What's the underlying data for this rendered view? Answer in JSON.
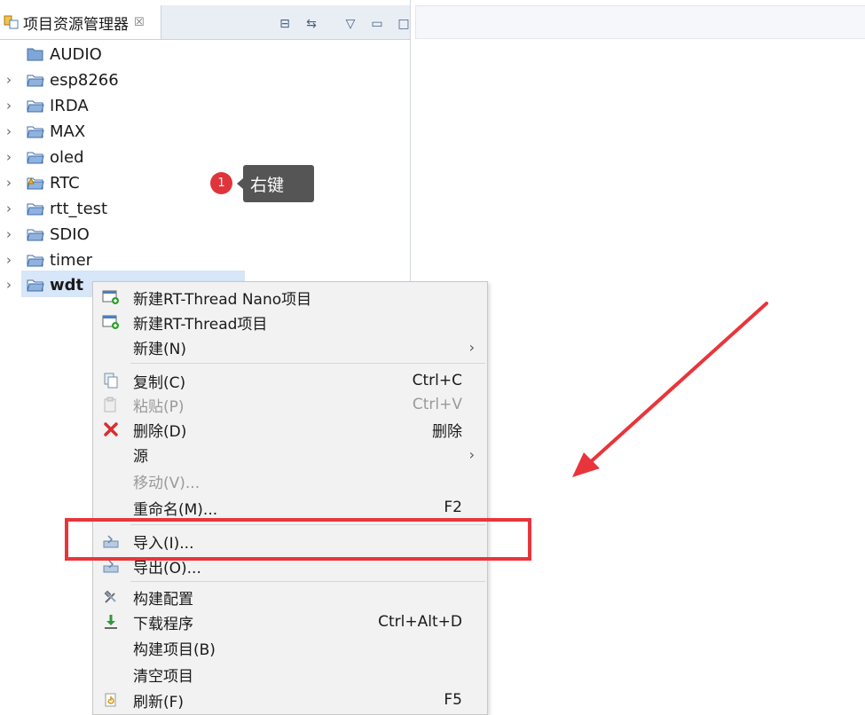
{
  "explorer": {
    "tab_title": "项目资源管理器",
    "tab_close": "☒",
    "tools": {
      "collapse": "⊟",
      "link": "⇆",
      "view_menu": "▽",
      "minimize": "▭",
      "maximize": "□"
    },
    "items": [
      {
        "label": "AUDIO",
        "expandable": false
      },
      {
        "label": "esp8266",
        "expandable": true
      },
      {
        "label": "IRDA",
        "expandable": true
      },
      {
        "label": "MAX",
        "expandable": true
      },
      {
        "label": "oled",
        "expandable": true
      },
      {
        "label": "RTC",
        "expandable": true
      },
      {
        "label": "rtt_test",
        "expandable": true
      },
      {
        "label": "SDIO",
        "expandable": true
      },
      {
        "label": "timer",
        "expandable": true
      },
      {
        "label": "wdt",
        "expandable": true,
        "selected": true
      }
    ],
    "chevron": "›"
  },
  "callout": {
    "step": "1",
    "text": "右键"
  },
  "context_menu": {
    "items": [
      {
        "label": "新建RT-Thread Nano项目",
        "shortcut": "",
        "icon": "new-project-icon"
      },
      {
        "label": "新建RT-Thread项目",
        "shortcut": "",
        "icon": "new-project-icon"
      },
      {
        "label": "新建(N)",
        "shortcut": "",
        "submenu": "›"
      },
      {
        "label": "复制(C)",
        "shortcut": "Ctrl+C",
        "icon": "copy-icon"
      },
      {
        "label": "粘贴(P)",
        "shortcut": "Ctrl+V",
        "icon": "paste-icon",
        "disabled": true
      },
      {
        "label": "删除(D)",
        "shortcut": "删除",
        "icon": "delete-icon"
      },
      {
        "label": "源",
        "shortcut": "",
        "submenu": "›"
      },
      {
        "label": "移动(V)...",
        "shortcut": "",
        "disabled": true
      },
      {
        "label": "重命名(M)...",
        "shortcut": "F2"
      },
      {
        "label": "导入(I)...",
        "shortcut": "",
        "icon": "import-icon"
      },
      {
        "label": "导出(O)...",
        "shortcut": "",
        "icon": "export-icon"
      },
      {
        "label": "构建配置",
        "shortcut": "",
        "icon": "build-config-icon"
      },
      {
        "label": "下载程序",
        "shortcut": "Ctrl+Alt+D",
        "icon": "download-icon"
      },
      {
        "label": "构建项目(B)",
        "shortcut": ""
      },
      {
        "label": "清空项目",
        "shortcut": ""
      },
      {
        "label": "刷新(F)",
        "shortcut": "F5",
        "icon": "refresh-icon"
      }
    ]
  },
  "colors": {
    "annotation_red": "#e8353b",
    "selection": "#d7e6f8",
    "folder": "#4a7fc1"
  }
}
